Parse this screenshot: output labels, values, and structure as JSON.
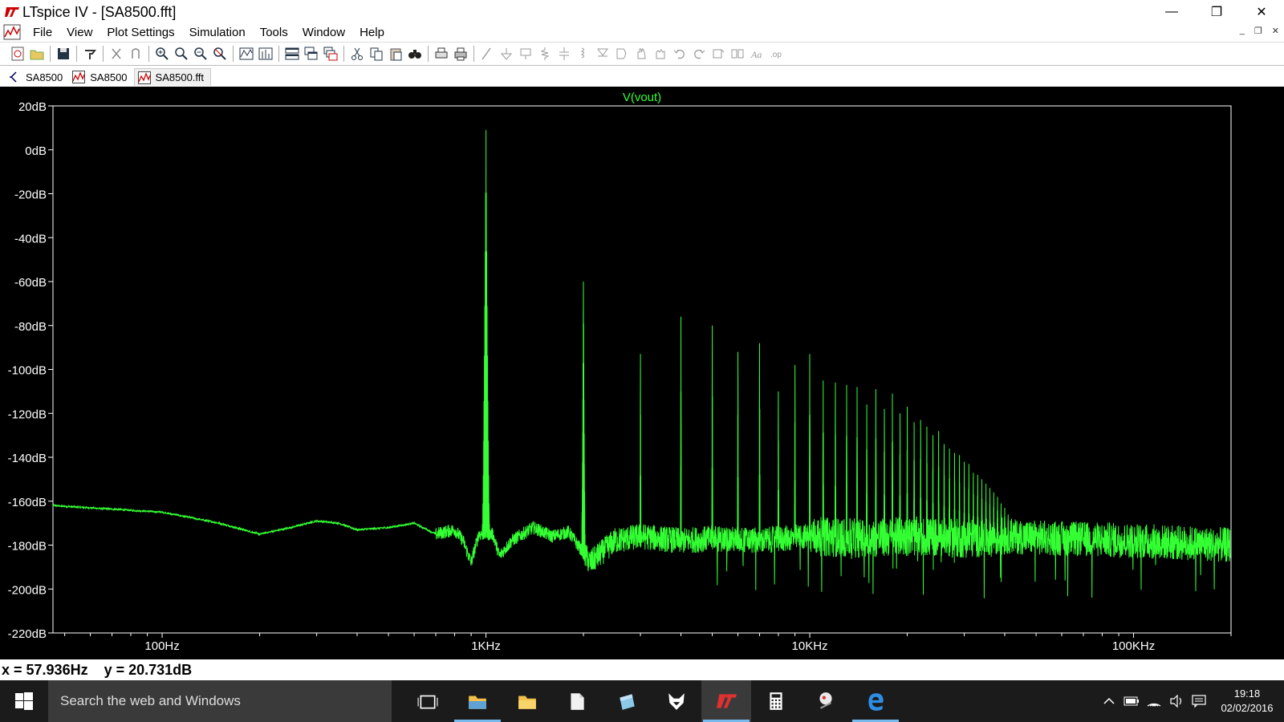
{
  "window": {
    "title": "LTspice IV - [SA8500.fft]",
    "minimize_glyph": "—",
    "restore_glyph": "❐",
    "close_glyph": "✕"
  },
  "menu": {
    "items": [
      "File",
      "View",
      "Plot Settings",
      "Simulation",
      "Tools",
      "Window",
      "Help"
    ],
    "mdi_minimize": "_",
    "mdi_restore": "❐",
    "mdi_close": "✕"
  },
  "toolbar": {
    "icons": [
      "new-schematic-icon",
      "open-icon",
      "|",
      "save-icon",
      "|",
      "control-panel-icon",
      "|",
      "run-icon",
      "halt-icon",
      "|",
      "zoom-in-icon",
      "zoom-pan-icon",
      "zoom-out-icon",
      "zoom-fit-icon",
      "|",
      "autorange-icon",
      "fft-icon",
      "|",
      "tile-horizontal-icon",
      "tile-vertical-icon",
      "cascade-icon",
      "|",
      "cut-icon",
      "copy-icon",
      "paste-icon",
      "find-icon",
      "|",
      "print-setup-icon",
      "print-icon",
      "|",
      "wire-icon",
      "ground-icon",
      "label-icon",
      "resistor-icon",
      "capacitor-icon",
      "inductor-icon",
      "diode-icon",
      "component-icon",
      "move-icon",
      "drag-icon",
      "undo-icon",
      "redo-icon",
      "rotate-icon",
      "mirror-icon",
      "text-icon",
      "spice-directive-icon"
    ]
  },
  "tabs": [
    {
      "label": "SA8500",
      "icon": "schematic-icon",
      "active": false
    },
    {
      "label": "SA8500",
      "icon": "waveform-icon",
      "active": false
    },
    {
      "label": "SA8500.fft",
      "icon": "waveform-icon",
      "active": true
    }
  ],
  "colors": {
    "trace": "#33ff33",
    "plot_bg": "#000000",
    "axis": "#ffffff",
    "title": "#33ff33"
  },
  "chart_data": {
    "type": "line",
    "title": "V(vout)",
    "xscale": "log",
    "xlim": [
      46,
      200000
    ],
    "ylim": [
      -220,
      20
    ],
    "x_ticks": [
      {
        "value": 100,
        "label": "100Hz"
      },
      {
        "value": 1000,
        "label": "1KHz"
      },
      {
        "value": 10000,
        "label": "10KHz"
      },
      {
        "value": 100000,
        "label": "100KHz"
      }
    ],
    "y_ticks": [
      {
        "value": 20,
        "label": "20dB"
      },
      {
        "value": 0,
        "label": "0dB"
      },
      {
        "value": -20,
        "label": "-20dB"
      },
      {
        "value": -40,
        "label": "-40dB"
      },
      {
        "value": -60,
        "label": "-60dB"
      },
      {
        "value": -80,
        "label": "-80dB"
      },
      {
        "value": -100,
        "label": "-100dB"
      },
      {
        "value": -120,
        "label": "-120dB"
      },
      {
        "value": -140,
        "label": "-140dB"
      },
      {
        "value": -160,
        "label": "-160dB"
      },
      {
        "value": -180,
        "label": "-180dB"
      },
      {
        "value": -200,
        "label": "-200dB"
      },
      {
        "value": -220,
        "label": "-220dB"
      }
    ],
    "series": [
      {
        "floor": [
          [
            46,
            -162
          ],
          [
            100,
            -165
          ],
          [
            150,
            -170
          ],
          [
            200,
            -175
          ],
          [
            250,
            -172
          ],
          [
            300,
            -169
          ],
          [
            350,
            -170
          ],
          [
            400,
            -173
          ],
          [
            500,
            -172
          ],
          [
            600,
            -170
          ],
          [
            700,
            -175
          ],
          [
            800,
            -173
          ],
          [
            850,
            -178
          ],
          [
            900,
            -188
          ],
          [
            950,
            -175
          ],
          [
            1050,
            -175
          ],
          [
            1100,
            -185
          ],
          [
            1200,
            -178
          ],
          [
            1400,
            -172
          ],
          [
            1600,
            -176
          ],
          [
            1800,
            -174
          ],
          [
            2100,
            -188
          ],
          [
            2500,
            -178
          ],
          [
            3000,
            -176
          ],
          [
            4000,
            -178
          ],
          [
            5000,
            -177
          ],
          [
            7000,
            -178
          ],
          [
            10000,
            -176
          ],
          [
            15000,
            -177
          ],
          [
            20000,
            -176
          ],
          [
            30000,
            -177
          ],
          [
            40000,
            -176
          ],
          [
            60000,
            -177
          ],
          [
            100000,
            -178
          ],
          [
            200000,
            -180
          ]
        ],
        "harmonics": [
          [
            1000,
            9
          ],
          [
            2000,
            -60
          ],
          [
            3000,
            -93
          ],
          [
            4000,
            -76
          ],
          [
            5000,
            -80
          ],
          [
            6000,
            -92
          ],
          [
            7000,
            -88
          ],
          [
            8000,
            -110
          ],
          [
            9000,
            -98
          ],
          [
            10000,
            -93
          ],
          [
            11000,
            -105
          ],
          [
            12000,
            -106
          ],
          [
            13000,
            -107
          ],
          [
            14000,
            -108
          ],
          [
            15000,
            -116
          ],
          [
            16000,
            -109
          ],
          [
            17000,
            -118
          ],
          [
            18000,
            -111
          ],
          [
            19000,
            -120
          ],
          [
            20000,
            -117
          ],
          [
            21000,
            -124
          ],
          [
            22000,
            -123
          ],
          [
            23000,
            -126
          ],
          [
            24000,
            -130
          ],
          [
            25000,
            -128
          ],
          [
            26000,
            -134
          ],
          [
            27000,
            -136
          ],
          [
            28000,
            -138
          ],
          [
            29000,
            -139
          ],
          [
            30000,
            -142
          ],
          [
            31000,
            -143
          ],
          [
            32000,
            -147
          ],
          [
            33000,
            -148
          ],
          [
            34000,
            -150
          ],
          [
            35000,
            -152
          ],
          [
            36000,
            -154
          ],
          [
            37000,
            -156
          ],
          [
            38000,
            -158
          ],
          [
            39000,
            -161
          ],
          [
            40000,
            -163
          ],
          [
            41000,
            -166
          ],
          [
            42000,
            -168
          ],
          [
            43000,
            -170
          ]
        ]
      }
    ]
  },
  "status": {
    "text": "x = 57.936Hz    y = 20.731dB"
  },
  "taskbar": {
    "search_placeholder": "Search the web and Windows",
    "apps": [
      {
        "name": "task-view-icon",
        "running": false,
        "active": false
      },
      {
        "name": "file-explorer-icon",
        "running": true,
        "active": false
      },
      {
        "name": "folder-icon",
        "running": false,
        "active": false
      },
      {
        "name": "document-icon",
        "running": false,
        "active": false
      },
      {
        "name": "notes-icon",
        "running": false,
        "active": false
      },
      {
        "name": "fox-icon",
        "running": false,
        "active": false
      },
      {
        "name": "ltspice-icon",
        "running": true,
        "active": true
      },
      {
        "name": "calculator-icon",
        "running": false,
        "active": false
      },
      {
        "name": "snipping-icon",
        "running": false,
        "active": false
      },
      {
        "name": "edge-icon",
        "running": true,
        "active": false
      }
    ],
    "time": "19:18",
    "date": "02/02/2016"
  }
}
